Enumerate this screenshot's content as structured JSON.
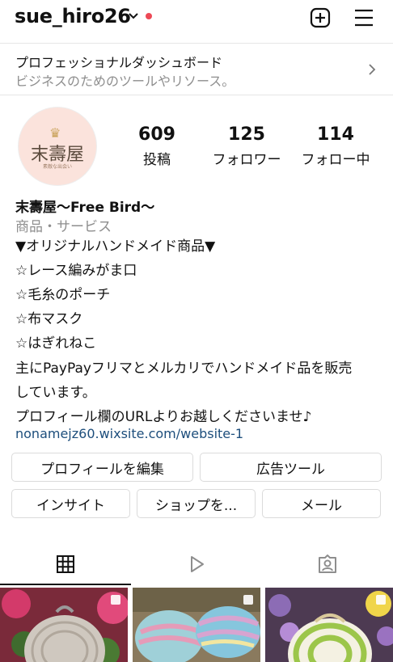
{
  "header": {
    "username": "sue_hiro26"
  },
  "dashboard": {
    "title": "プロフェッショナルダッシュボード",
    "subtitle": "ビジネスのためのツールやリソース。"
  },
  "avatar": {
    "logo_text": "末壽屋",
    "small_text": "素敵な出会い"
  },
  "stats": [
    {
      "value": "609",
      "label": "投稿"
    },
    {
      "value": "125",
      "label": "フォロワー"
    },
    {
      "value": "114",
      "label": "フォロー中"
    }
  ],
  "bio": {
    "name": "末壽屋〜Free Bird〜",
    "category": "商品・サービス",
    "lines": [
      "▼オリジナルハンドメイド商品▼",
      "☆レース編みがま口",
      "☆毛糸のポーチ",
      "☆布マスク",
      "☆はぎれねこ",
      "主にPayPayフリマとメルカリでハンドメイド品を販売",
      "しています。",
      "プロフィール欄のURLよりお越しくださいませ♪"
    ],
    "link": "nonamejz60.wixsite.com/website-1"
  },
  "buttons": {
    "edit_profile": "プロフィールを編集",
    "ad_tools": "広告ツール",
    "insights": "インサイト",
    "shop": "ショップを...",
    "email": "メール"
  },
  "tabs": [
    "grid-icon",
    "reels-icon",
    "tagged-icon"
  ],
  "colors": {
    "notification_dot": "#ed4956",
    "link": "#1d4e7c",
    "secondary_text": "#8e8e8e"
  }
}
